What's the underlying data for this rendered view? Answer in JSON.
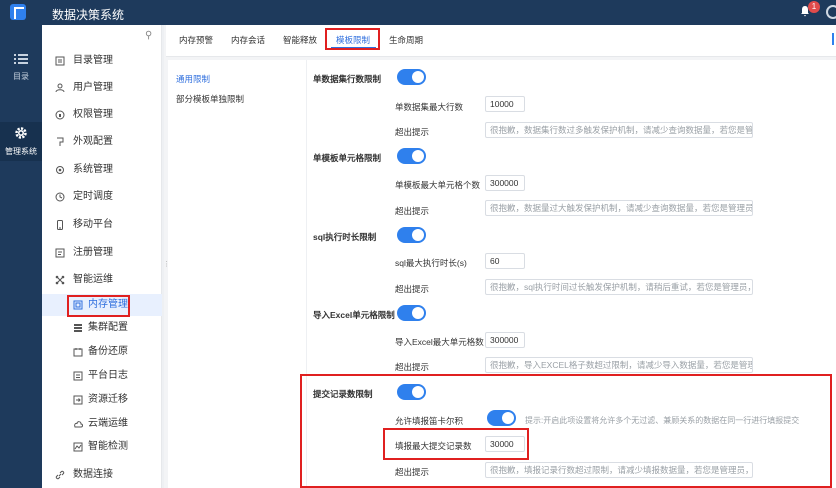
{
  "app": {
    "title": "数据决策系统",
    "badge_count": "1"
  },
  "rail": [
    {
      "label": "目录",
      "icon": "list-icon"
    },
    {
      "label": "管理系统",
      "icon": "gear-icon"
    }
  ],
  "sidebar": {
    "items": [
      {
        "label": "目录管理",
        "icon": "folder-icon"
      },
      {
        "label": "用户管理",
        "icon": "user-icon"
      },
      {
        "label": "权限管理",
        "icon": "lock-icon"
      },
      {
        "label": "外观配置",
        "icon": "palette-icon"
      },
      {
        "label": "系统管理",
        "icon": "settings-icon"
      },
      {
        "label": "定时调度",
        "icon": "clock-icon"
      },
      {
        "label": "移动平台",
        "icon": "mobile-icon"
      },
      {
        "label": "注册管理",
        "icon": "register-icon"
      },
      {
        "label": "智能运维",
        "icon": "ops-icon"
      }
    ],
    "sub_items": [
      {
        "label": "内存管理",
        "icon": "memory-icon",
        "active": true
      },
      {
        "label": "集群配置",
        "icon": "cluster-icon"
      },
      {
        "label": "备份还原",
        "icon": "backup-icon"
      },
      {
        "label": "平台日志",
        "icon": "log-icon"
      },
      {
        "label": "资源迁移",
        "icon": "migrate-icon"
      },
      {
        "label": "云端运维",
        "icon": "cloud-icon"
      },
      {
        "label": "智能检测",
        "icon": "detect-icon"
      }
    ],
    "last_item": {
      "label": "数据连接",
      "icon": "link-icon"
    }
  },
  "tabs": [
    {
      "label": "内存预警"
    },
    {
      "label": "内存会话"
    },
    {
      "label": "智能释放"
    },
    {
      "label": "模板限制",
      "active": true
    },
    {
      "label": "生命周期"
    }
  ],
  "list": [
    {
      "label": "通用限制",
      "active": true
    },
    {
      "label": "部分模板单独限制"
    }
  ],
  "sections": [
    {
      "title": "单数据集行数限制",
      "fields": [
        {
          "label": "单数据集最大行数",
          "value": "10000"
        },
        {
          "label": "超出提示",
          "value": "很抱歉，数据集行数过多触发保护机制，请减少查询数据量，若您是管..."
        }
      ]
    },
    {
      "title": "单模板单元格限制",
      "fields": [
        {
          "label": "单模板最大单元格个数",
          "value": "300000"
        },
        {
          "label": "超出提示",
          "value": "很抱歉，数据量过大触发保护机制，请减少查询数据量，若您是管理员..."
        }
      ]
    },
    {
      "title": "sql执行时长限制",
      "fields": [
        {
          "label": "sql最大执行时长(s)",
          "value": "60"
        },
        {
          "label": "超出提示",
          "value": "很抱歉，sql执行时间过长触发保护机制，请稍后重试，若您是管理员，..."
        }
      ]
    },
    {
      "title": "导入Excel单元格限制",
      "fields": [
        {
          "label": "导入Excel最大单元格数",
          "value": "300000"
        },
        {
          "label": "超出提示",
          "value": "很抱歉，导入EXCEL格子数超过限制，请减少导入数据量，若您是管理..."
        }
      ]
    },
    {
      "title": "提交记录数限制",
      "toggle_row": {
        "label": "允许填报笛卡尔积",
        "hint": "提示:开启此项设置将允许多个无过滤、兼顾关系的数据在同一行进行填报提交"
      },
      "fields": [
        {
          "label": "填报最大提交记录数",
          "value": "30000"
        },
        {
          "label": "超出提示",
          "value": "很抱歉，填报记录行数超过限制，请减少填报数据量，若您是管理员，..."
        }
      ]
    }
  ]
}
